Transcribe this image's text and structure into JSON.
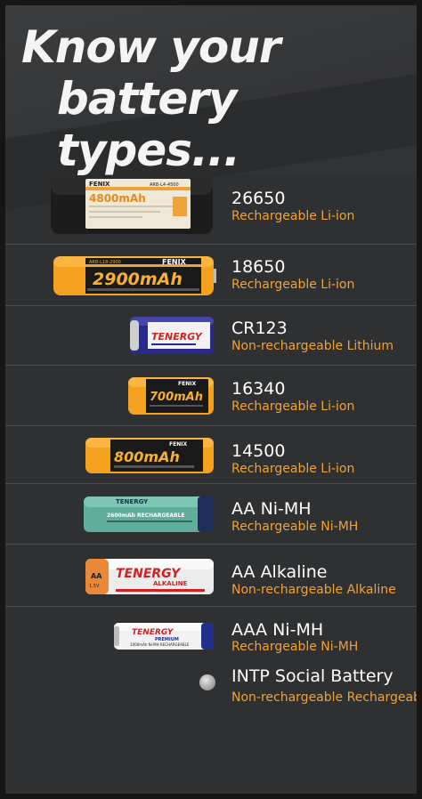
{
  "header": {
    "line1": "Know your",
    "line2": "battery types..."
  },
  "batteries": [
    {
      "name": "26650",
      "desc": "Rechargeable Li-ion",
      "label_brand": "FENIX",
      "label_capacity": "4800mAh",
      "label_model": "ARB-L4-4500"
    },
    {
      "name": "18650",
      "desc": "Rechargeable Li-ion",
      "label_brand": "FENIX",
      "label_capacity": "2900mAh",
      "label_model": "ARB-L18-2900"
    },
    {
      "name": "CR123",
      "desc": "Non-rechargeable Lithium",
      "label_brand": "TENERGY"
    },
    {
      "name": "16340",
      "desc": "Rechargeable Li-ion",
      "label_brand": "FENIX",
      "label_capacity": "700mAh"
    },
    {
      "name": "14500",
      "desc": "Rechargeable Li-ion",
      "label_brand": "FENIX",
      "label_capacity": "800mAh"
    },
    {
      "name": "AA Ni-MH",
      "desc": "Rechargeable Ni-MH",
      "label_brand": "TENERGY",
      "label_capacity": "2600mAh RECHARGEABLE"
    },
    {
      "name": "AA Alkaline",
      "desc": "Non-rechargeable Alkaline",
      "label_brand": "TENERGY",
      "label_sub": "ALKALINE",
      "label_size": "AA",
      "label_voltage": "1.5V"
    },
    {
      "name": "AAA Ni-MH",
      "desc": "Rechargeable Ni-MH",
      "label_brand": "TENERGY",
      "label_sub": "PREMIUM",
      "label_capacity": "1000mAh Ni-MH RECHARGEABLE"
    },
    {
      "name": "INTP Social Battery",
      "desc": "Non-rechargeable Rechargeable"
    }
  ],
  "colors": {
    "accent": "#f0a23a",
    "background": "#2f3031",
    "text": "#ffffff"
  }
}
